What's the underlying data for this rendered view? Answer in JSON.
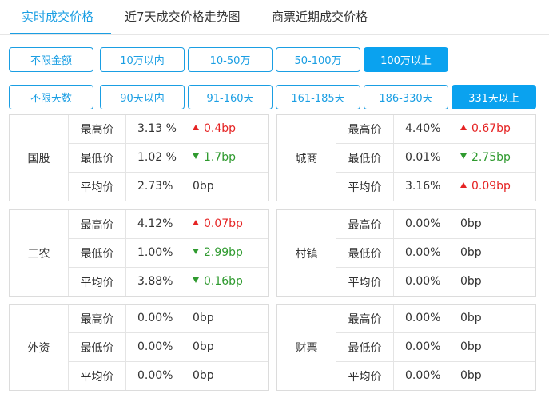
{
  "tabs": [
    "实时成交价格",
    "近7天成交价格走势图",
    "商票近期成交价格"
  ],
  "amount_filters": [
    "不限金额",
    "10万以内",
    "10-50万",
    "50-100万",
    "100万以上"
  ],
  "term_filters": [
    "不限天数",
    "90天以内",
    "91-160天",
    "161-185天",
    "186-330天",
    "331天以上"
  ],
  "labels": {
    "high": "最高价",
    "low": "最低价",
    "avg": "平均价"
  },
  "cards": [
    {
      "name": "国股",
      "rows": [
        {
          "value": "3.13 %",
          "change": "0.4bp",
          "trend": "up"
        },
        {
          "value": "1.02 %",
          "change": "1.7bp",
          "trend": "down"
        },
        {
          "value": "2.73%",
          "change": "0bp",
          "trend": "flat"
        }
      ]
    },
    {
      "name": "城商",
      "rows": [
        {
          "value": "4.40%",
          "change": "0.67bp",
          "trend": "up"
        },
        {
          "value": "0.01%",
          "change": "2.75bp",
          "trend": "down"
        },
        {
          "value": "3.16%",
          "change": "0.09bp",
          "trend": "up"
        }
      ]
    },
    {
      "name": "三农",
      "rows": [
        {
          "value": "4.12%",
          "change": "0.07bp",
          "trend": "up"
        },
        {
          "value": "1.00%",
          "change": "2.99bp",
          "trend": "down"
        },
        {
          "value": "3.88%",
          "change": "0.16bp",
          "trend": "down"
        }
      ]
    },
    {
      "name": "村镇",
      "rows": [
        {
          "value": "0.00%",
          "change": "0bp",
          "trend": "flat"
        },
        {
          "value": "0.00%",
          "change": "0bp",
          "trend": "flat"
        },
        {
          "value": "0.00%",
          "change": "0bp",
          "trend": "flat"
        }
      ]
    },
    {
      "name": "外资",
      "rows": [
        {
          "value": "0.00%",
          "change": "0bp",
          "trend": "flat"
        },
        {
          "value": "0.00%",
          "change": "0bp",
          "trend": "flat"
        },
        {
          "value": "0.00%",
          "change": "0bp",
          "trend": "flat"
        }
      ]
    },
    {
      "name": "财票",
      "rows": [
        {
          "value": "0.00%",
          "change": "0bp",
          "trend": "flat"
        },
        {
          "value": "0.00%",
          "change": "0bp",
          "trend": "flat"
        },
        {
          "value": "0.00%",
          "change": "0bp",
          "trend": "flat"
        }
      ]
    }
  ],
  "colors": {
    "accent": "#1a9ee3",
    "active_fill": "#0aa2ef",
    "up": "#e52323",
    "down": "#2f9a2f"
  }
}
